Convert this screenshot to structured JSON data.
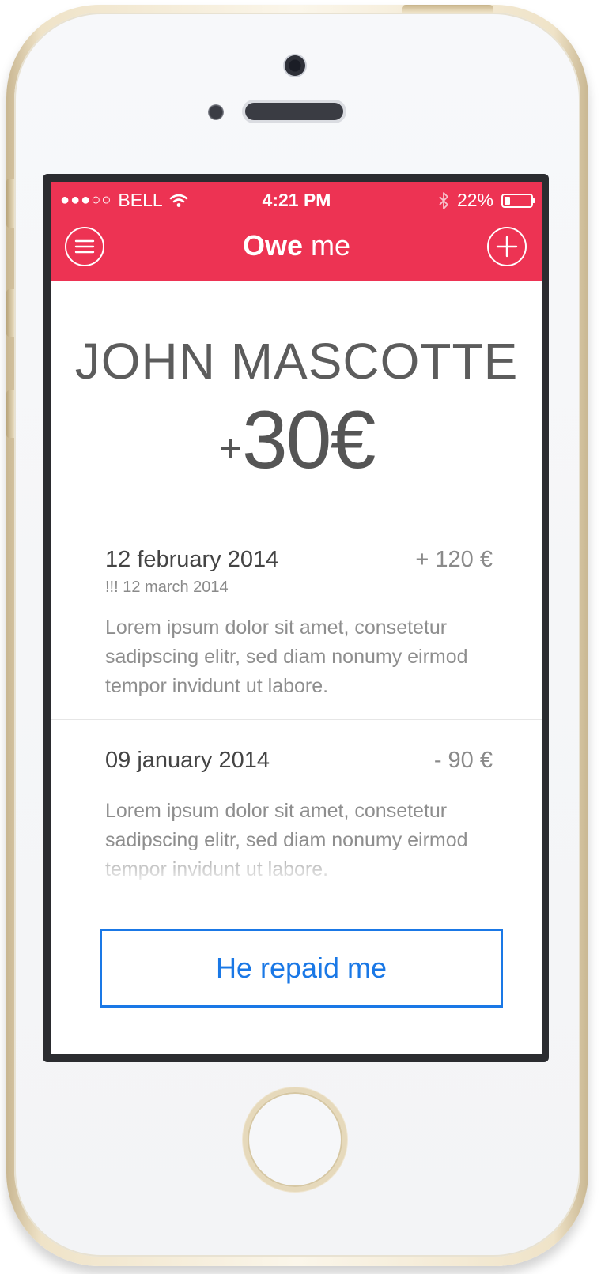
{
  "status_bar": {
    "signal": "●●●○○",
    "carrier": "BELL",
    "time": "4:21 PM",
    "battery_percent": "22%",
    "battery_level": 0.22
  },
  "header": {
    "title_bold": "Owe",
    "title_light": "me",
    "menu_icon": "menu-icon",
    "add_icon": "plus-circle-icon"
  },
  "summary": {
    "person_name": "JOHN MASCOTTE",
    "balance_sign": "+",
    "balance_amount": "30€"
  },
  "entries": [
    {
      "date": "12 february 2014",
      "due": "!!! 12 march 2014",
      "amount": "+ 120 €",
      "description": "Lorem ipsum dolor sit amet, consetetur sadipscing elitr, sed diam nonumy eirmod tempor invidunt ut labore."
    },
    {
      "date": "09 january 2014",
      "amount": "- 90 €",
      "description": "Lorem ipsum dolor sit amet, consetetur sadipscing elitr, sed diam nonumy eirmod tempor invidunt ut labore."
    }
  ],
  "action": {
    "repaid_label": "He repaid me"
  },
  "colors": {
    "header": "#ed3353",
    "accent_blue": "#1a78e6"
  }
}
